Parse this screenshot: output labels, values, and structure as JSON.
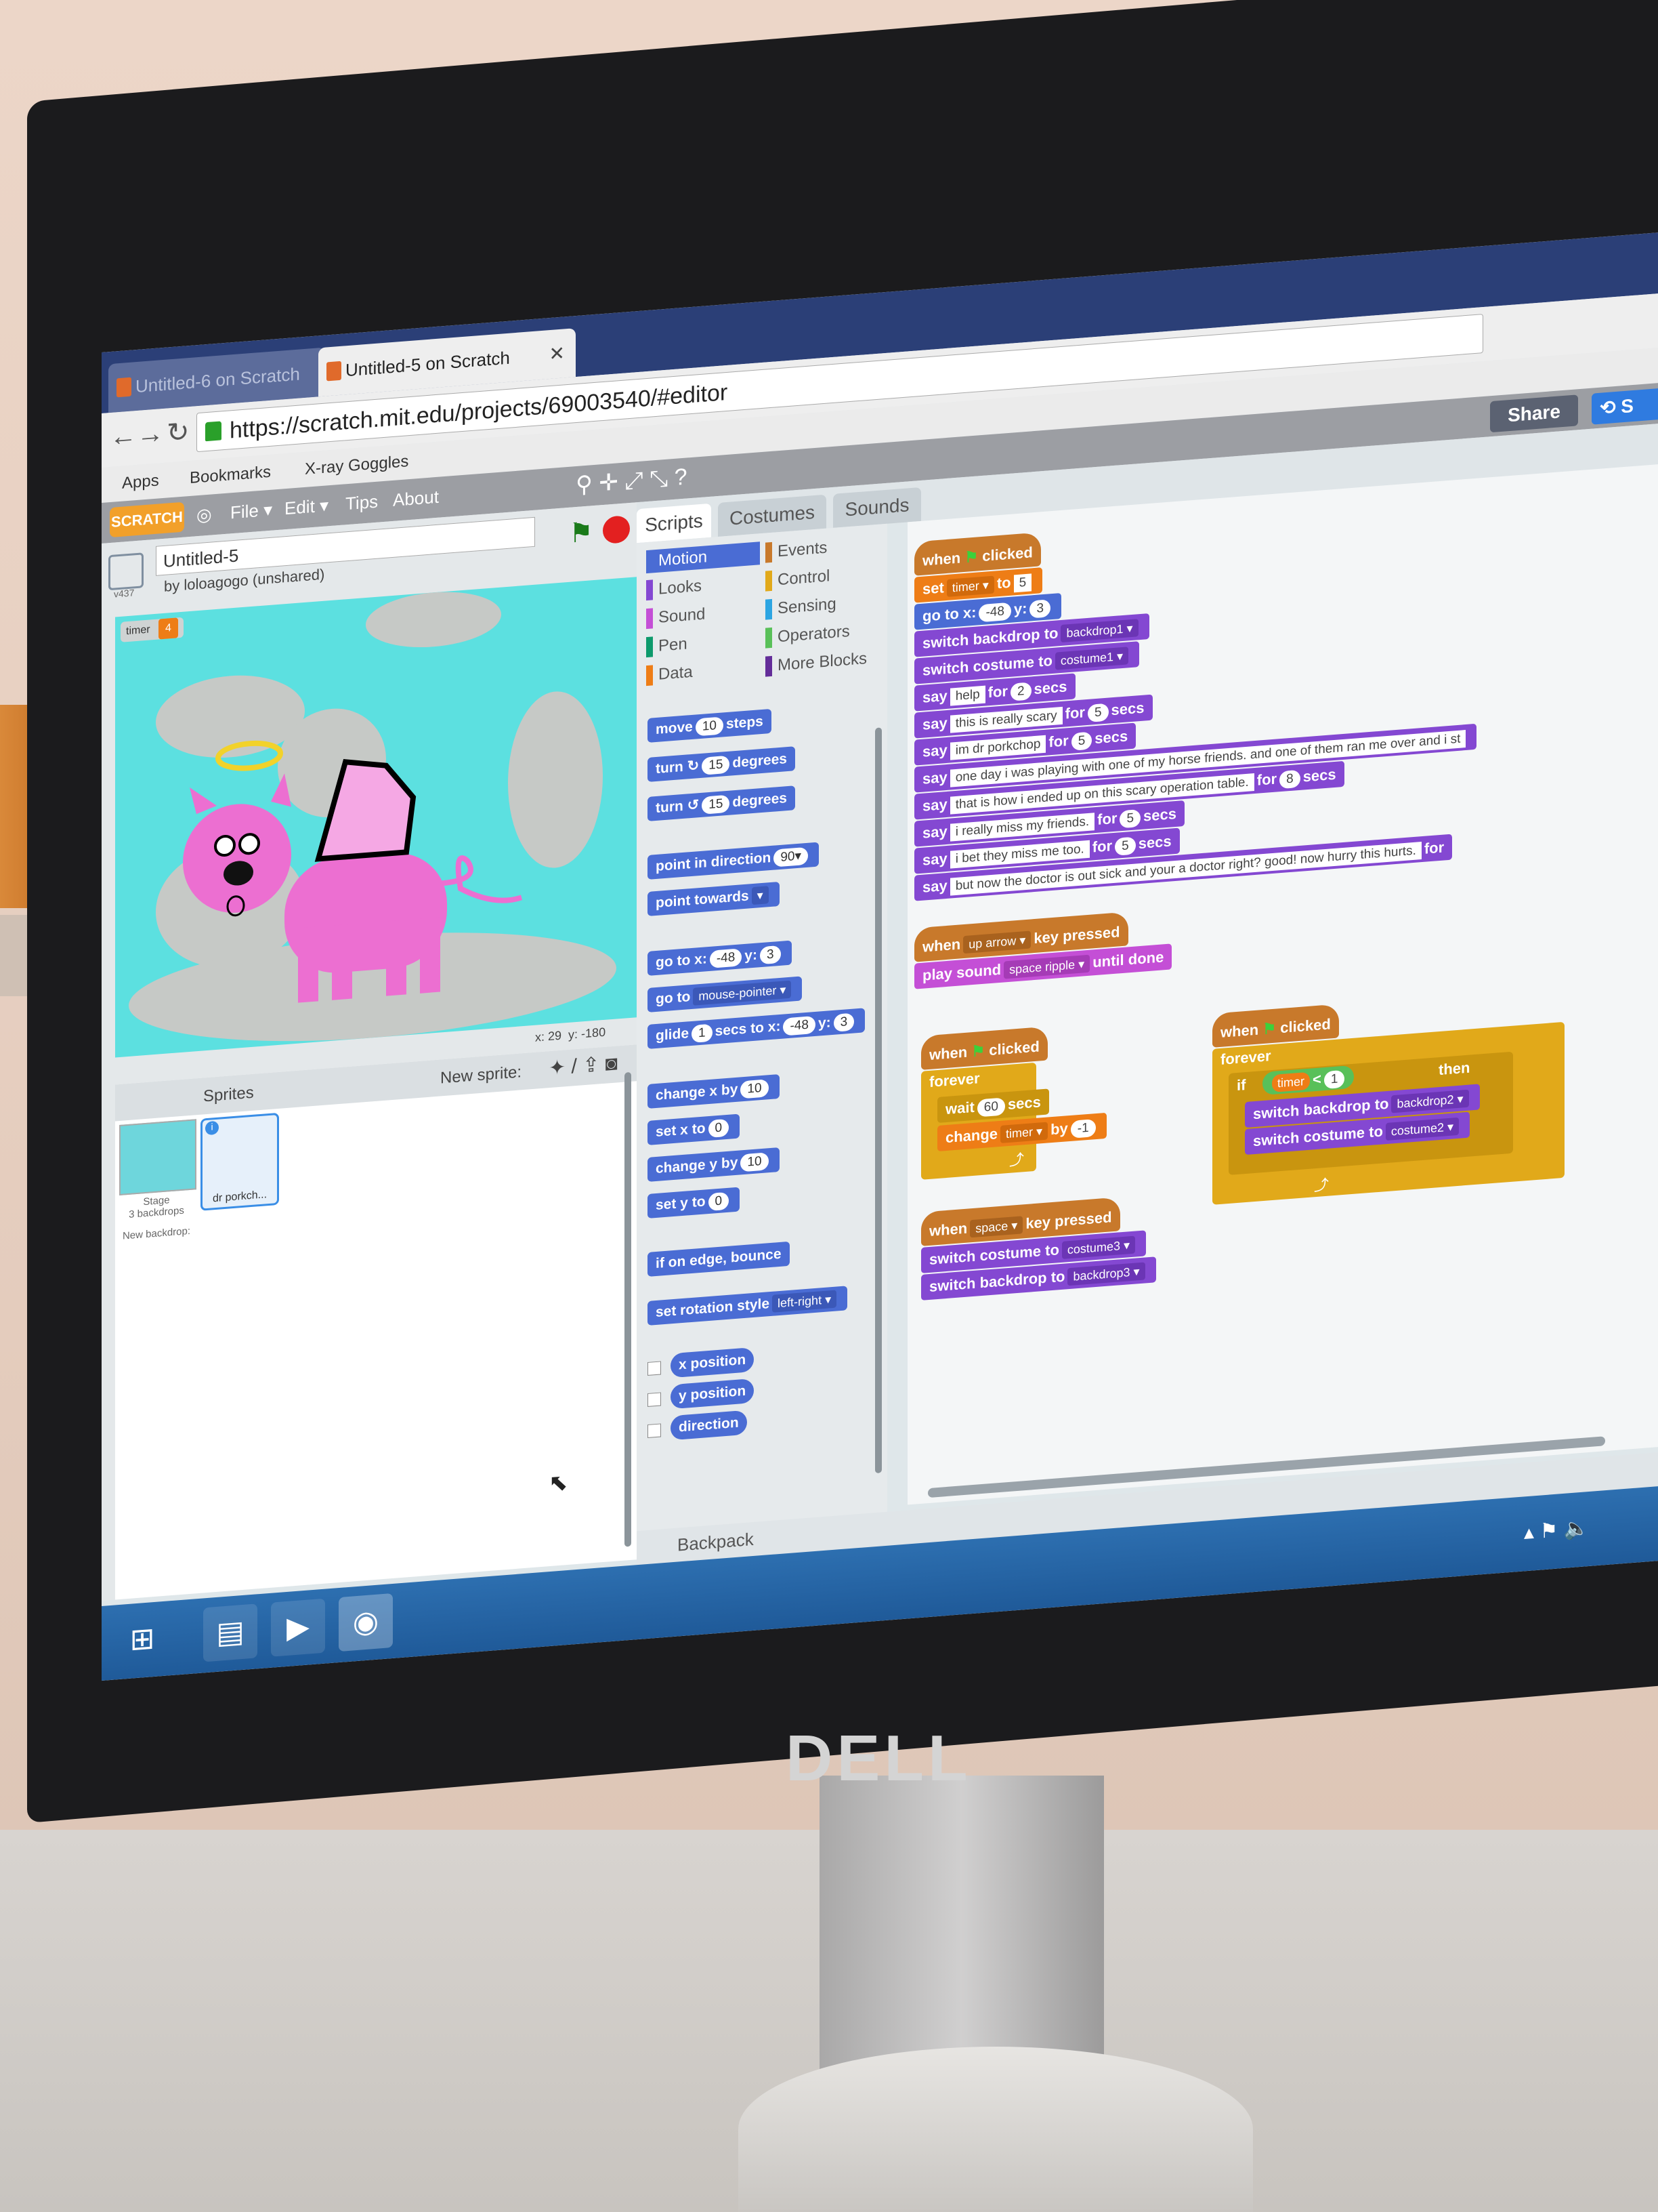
{
  "browser": {
    "tabs": [
      {
        "label": "Untitled-6 on Scratch",
        "active": false
      },
      {
        "label": "Untitled-5 on Scratch",
        "active": true
      }
    ],
    "url": "https://scratch.mit.edu/projects/69003540/#editor",
    "bookmarks": [
      "Apps",
      "Bookmarks",
      "X-ray Goggles"
    ]
  },
  "scratch": {
    "logo": "SCRATCH",
    "menu": [
      "File ▾",
      "Edit ▾",
      "Tips",
      "About"
    ],
    "share_label": "Share",
    "see_label": "S",
    "project_title": "Untitled-5",
    "owner": "by loloagogo (unshared)",
    "version": "v437",
    "variable_monitor": {
      "name": "timer",
      "value": "4"
    },
    "stage_coords": {
      "x_label": "x: 29",
      "y_label": "y: -180"
    },
    "sprites_heading": "Sprites",
    "new_sprite_label": "New sprite:",
    "stage_thumb": {
      "label": "Stage",
      "sub": "3 backdrops"
    },
    "new_backdrop_label": "New backdrop:",
    "sprite_name": "dr porkch..."
  },
  "editor_tabs": [
    "Scripts",
    "Costumes",
    "Sounds"
  ],
  "categories": {
    "left": [
      {
        "label": "Motion",
        "color": "#4a6cd4",
        "selected": true
      },
      {
        "label": "Looks",
        "color": "#8448d2"
      },
      {
        "label": "Sound",
        "color": "#c44fd6"
      },
      {
        "label": "Pen",
        "color": "#0e9a6c"
      },
      {
        "label": "Data",
        "color": "#ee7d16"
      }
    ],
    "right": [
      {
        "label": "Events",
        "color": "#c8792b"
      },
      {
        "label": "Control",
        "color": "#e1a91a"
      },
      {
        "label": "Sensing",
        "color": "#2ca5e2"
      },
      {
        "label": "Operators",
        "color": "#59c059"
      },
      {
        "label": "More Blocks",
        "color": "#632d99"
      }
    ]
  },
  "palette": {
    "move": {
      "a": "move",
      "v": "10",
      "b": "steps"
    },
    "turn_cw": {
      "a": "turn ↻",
      "v": "15",
      "b": "degrees"
    },
    "turn_ccw": {
      "a": "turn ↺",
      "v": "15",
      "b": "degrees"
    },
    "point_dir": {
      "a": "point in direction",
      "v": "90▾"
    },
    "point_towards": {
      "a": "point towards",
      "v": "▾"
    },
    "goto_xy": {
      "a": "go to x:",
      "x": "-48",
      "b": "y:",
      "y": "3"
    },
    "goto": {
      "a": "go to",
      "v": "mouse-pointer ▾"
    },
    "glide": {
      "a": "glide",
      "s": "1",
      "b": "secs to x:",
      "x": "-48",
      "c": "y:",
      "y": "3"
    },
    "change_x": {
      "a": "change x by",
      "v": "10"
    },
    "set_x": {
      "a": "set x to",
      "v": "0"
    },
    "change_y": {
      "a": "change y by",
      "v": "10"
    },
    "set_y": {
      "a": "set y to",
      "v": "0"
    },
    "bounce": "if on edge, bounce",
    "rot_style": {
      "a": "set rotation style",
      "v": "left-right ▾"
    },
    "reporters": [
      "x position",
      "y position",
      "direction"
    ],
    "backpack": "Backpack"
  },
  "scripts": {
    "s1": {
      "hat": {
        "a": "when",
        "b": "clicked"
      },
      "set_timer": {
        "a": "set",
        "var": "timer ▾",
        "b": "to",
        "v": "5"
      },
      "goto": {
        "a": "go to x:",
        "x": "-48",
        "b": "y:",
        "y": "3"
      },
      "backdrop": {
        "a": "switch backdrop to",
        "v": "backdrop1 ▾"
      },
      "costume": {
        "a": "switch costume to",
        "v": "costume1 ▾"
      },
      "says": [
        {
          "text": "help",
          "secs": "2"
        },
        {
          "text": "this is really scary",
          "secs": "5"
        },
        {
          "text": "im dr porkchop",
          "secs": "5"
        },
        {
          "text": "one day i was playing with one of my horse friends. and one of them ran me over and i st",
          "secs": ""
        },
        {
          "text": "that is how i ended up on this scary operation table.",
          "secs": "8"
        },
        {
          "text": "i really miss my friends.",
          "secs": "5"
        },
        {
          "text": "i bet they miss me too.",
          "secs": "5"
        },
        {
          "text": "but now the doctor is out sick and your a doctor right? good! now hurry this hurts.",
          "secs": "for"
        }
      ]
    },
    "s2": {
      "hat": {
        "a": "when",
        "key": "up arrow ▾",
        "b": "key pressed"
      },
      "sound": {
        "a": "play sound",
        "v": "space ripple ▾",
        "b": "until done"
      }
    },
    "s3": {
      "hat": {
        "a": "when",
        "b": "clicked"
      },
      "forever": "forever",
      "wait": {
        "a": "wait",
        "v": "60",
        "b": "secs"
      },
      "change": {
        "a": "change",
        "var": "timer ▾",
        "b": "by",
        "v": "-1"
      }
    },
    "s4": {
      "hat": {
        "a": "when",
        "key": "space ▾",
        "b": "key pressed"
      },
      "costume": {
        "a": "switch costume to",
        "v": "costume3 ▾"
      },
      "backdrop": {
        "a": "switch backdrop to",
        "v": "backdrop3 ▾"
      }
    },
    "s5": {
      "hat": {
        "a": "when",
        "b": "clicked"
      },
      "forever": "forever",
      "if": {
        "a": "if",
        "var": "timer",
        "op": "<",
        "v": "1",
        "b": "then"
      },
      "backdrop": {
        "a": "switch backdrop to",
        "v": "backdrop2 ▾"
      },
      "costume": {
        "a": "switch costume to",
        "v": "costume2 ▾"
      }
    }
  },
  "monitor_brand": "DELL"
}
